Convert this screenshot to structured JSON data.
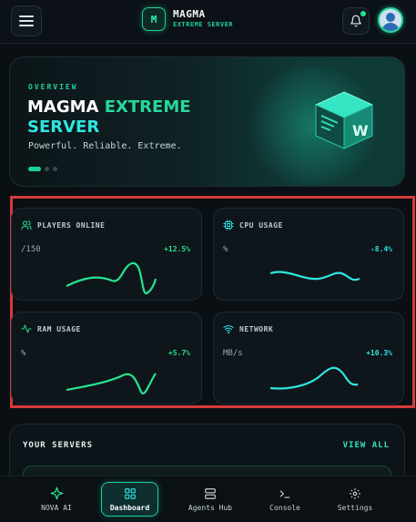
{
  "header": {
    "brand_logo_letter": "M",
    "brand_name": "MAGMA",
    "brand_subtitle": "EXTREME SERVER",
    "notifications_has_unread": true
  },
  "hero": {
    "eyebrow": "OVERVIEW",
    "title_part1": "MAGMA ",
    "title_part2": "EXTREME",
    "title_part3": "SERVER",
    "tagline": "Powerful. Reliable. Extreme.",
    "logo_letter": "W",
    "carousel_active_index": 0,
    "carousel_count": 3
  },
  "stats": [
    {
      "label": "PLAYERS ONLINE",
      "value": "/150",
      "change": "+12.5%",
      "change_color": "#27e38f",
      "icon": "users-icon"
    },
    {
      "label": "CPU USAGE",
      "value": "%",
      "change": "-8.4%",
      "change_color": "#2ee5e0",
      "icon": "cpu-icon"
    },
    {
      "label": "RAM USAGE",
      "value": "%",
      "change": "+5.7%",
      "change_color": "#27e38f",
      "icon": "activity-icon"
    },
    {
      "label": "NETWORK",
      "value": "MB/s",
      "change": "+10.3%",
      "change_color": "#2ee5e0",
      "icon": "wifi-icon"
    }
  ],
  "servers": {
    "title": "YOUR SERVERS",
    "view_all": "VIEW ALL"
  },
  "nav": {
    "items": [
      {
        "label": "NOVA AI",
        "icon": "sparkle-icon"
      },
      {
        "label": "Dashboard",
        "icon": "grid-icon"
      },
      {
        "label": "Agents Hub",
        "icon": "server-icon"
      },
      {
        "label": "Console",
        "icon": "terminal-icon"
      },
      {
        "label": "Settings",
        "icon": "gear-icon"
      }
    ],
    "active_index": 1
  },
  "colors": {
    "accent_green": "#1fd19a",
    "accent_cyan": "#2ee5e0",
    "background": "#0a0f14",
    "highlight_border": "#d63b3b"
  }
}
